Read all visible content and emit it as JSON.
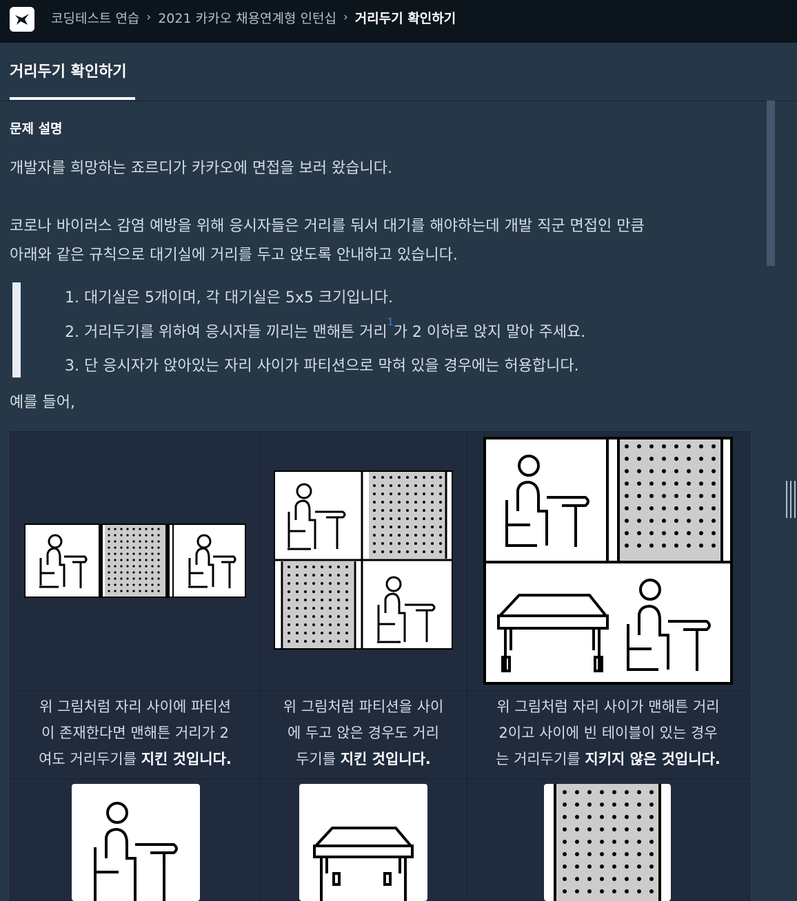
{
  "breadcrumb": {
    "items": [
      "코딩테스트 연습",
      "2021 카카오 채용연계형 인턴십"
    ],
    "current": "거리두기 확인하기"
  },
  "tab": {
    "label": "거리두기 확인하기"
  },
  "problem": {
    "section_title": "문제 설명",
    "intro": "개발자를 희망하는 죠르디가 카카오에 면접을 보러 왔습니다.",
    "para_line1": "코로나 바이러스 감염 예방을 위해 응시자들은 거리를 둬서 대기를 해야하는데 개발 직군 면접인 만큼",
    "para_line2": "아래와 같은 규칙으로 대기실에 거리를 두고 앉도록 안내하고 있습니다.",
    "rules": [
      "1. 대기실은 5개이며, 각 대기실은 5x5 크기입니다.",
      "2. 거리두기를 위하여 응시자들 끼리는 맨해튼 거리",
      "3. 단 응시자가 앉아있는 자리 사이가 파티션으로 막혀 있을 경우에는 허용합니다."
    ],
    "rule2_footnote": "1",
    "rule2_tail": "가 2 이하로 앉지 말아 주세요.",
    "example_label": "예를 들어,"
  },
  "examples": [
    {
      "caption_l1": "위 그림처럼 자리 사이에 파티션",
      "caption_l2": "이 존재한다면 맨해튼 거리가 2",
      "caption_l3a": "여도 거리두기를 ",
      "caption_l3b": "지킨 것입니다."
    },
    {
      "caption_l1": "위 그림처럼 파티션을 사이",
      "caption_l2": "에 두고 앉은 경우도 거리",
      "caption_l3a": "두기를 ",
      "caption_l3b": "지킨 것입니다."
    },
    {
      "caption_l1": "위 그림처럼 자리 사이가 맨해튼 거리",
      "caption_l2": "2이고 사이에 빈 테이블이 있는 경우",
      "caption_l3a": "는 거리두기를 ",
      "caption_l3b": "지키지 않은 것입니다."
    }
  ],
  "colors": {
    "background": "#263747",
    "topbar": "#0c151c",
    "table_bg": "#202b3d",
    "footnote_link": "#3b88f7"
  }
}
